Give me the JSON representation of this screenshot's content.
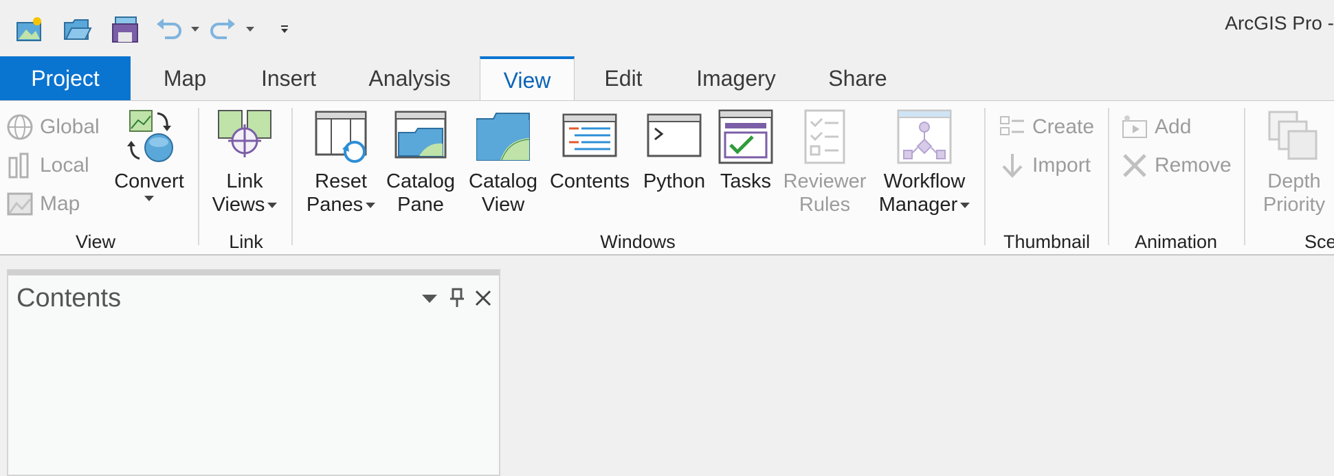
{
  "app": {
    "title": "ArcGIS Pro -"
  },
  "quick_access": {
    "icons": [
      "new-project-icon",
      "open-project-icon",
      "save-project-icon",
      "undo-icon",
      "redo-icon",
      "customize-toolbar-icon"
    ]
  },
  "tabs": [
    {
      "label": "Project"
    },
    {
      "label": "Map"
    },
    {
      "label": "Insert"
    },
    {
      "label": "Analysis"
    },
    {
      "label": "View"
    },
    {
      "label": "Edit"
    },
    {
      "label": "Imagery"
    },
    {
      "label": "Share"
    }
  ],
  "ribbon": {
    "view_group": {
      "label": "View",
      "global": "Global",
      "local": "Local",
      "map": "Map",
      "convert": "Convert"
    },
    "link_group": {
      "label": "Link",
      "link_line1": "Link",
      "link_line2": "Views"
    },
    "windows_group": {
      "label": "Windows",
      "reset_line1": "Reset",
      "reset_line2": "Panes",
      "catalog_pane_line1": "Catalog",
      "catalog_pane_line2": "Pane",
      "catalog_view_line1": "Catalog",
      "catalog_view_line2": "View",
      "contents": "Contents",
      "python": "Python",
      "tasks": "Tasks",
      "reviewer_line1": "Reviewer",
      "reviewer_line2": "Rules",
      "workflow_line1": "Workflow",
      "workflow_line2": "Manager"
    },
    "thumbnail_group": {
      "label": "Thumbnail",
      "create": "Create",
      "import": "Import"
    },
    "animation_group": {
      "label": "Animation",
      "add": "Add",
      "remove": "Remove"
    },
    "scene_group": {
      "label": "Sce",
      "depth_line1": "Depth",
      "depth_line2": "Priority"
    }
  },
  "contents_pane": {
    "title": "Contents"
  },
  "colors": {
    "accent": "#0a74d1",
    "ribbon_bg": "#fbfbfb",
    "disabled_text": "#9c9c9c"
  }
}
